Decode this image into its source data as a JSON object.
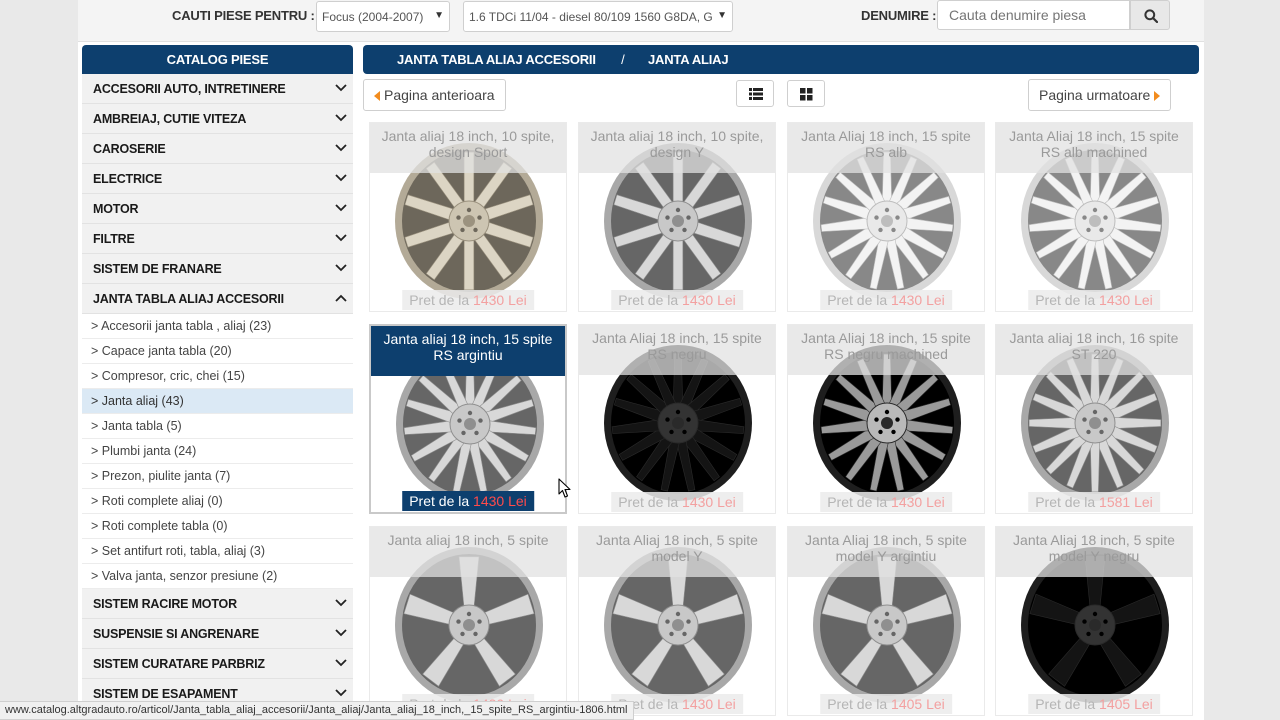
{
  "topbar": {
    "label_find": "CAUTI PIESE PENTRU :",
    "model_select": "Focus (2004-2007)",
    "engine_select": "1.6 TDCi 11/04 - diesel 80/109 1560 G8DA, G",
    "label_name": "DENUMIRE :",
    "search_placeholder": "Cauta denumire piesa"
  },
  "sidebar": {
    "title": "CATALOG PIESE",
    "categories_top": [
      "ACCESORII AUTO, INTRETINERE",
      "AMBREIAJ, CUTIE VITEZA",
      "CAROSERIE",
      "ELECTRICE",
      "MOTOR",
      "FILTRE",
      "SISTEM DE FRANARE"
    ],
    "expanded_category": "JANTA TABLA ALIAJ ACCESORII",
    "subcategories": [
      "> Accesorii janta tabla , aliaj (23)",
      "> Capace janta tabla (20)",
      "> Compresor, cric, chei (15)",
      "> Janta aliaj (43)",
      "> Janta tabla (5)",
      "> Plumbi janta (24)",
      "> Prezon, piulite janta (7)",
      "> Roti complete aliaj (0)",
      "> Roti complete tabla (0)",
      "> Set antifurt roti, tabla, aliaj (3)",
      "> Valva janta, senzor presiune (2)"
    ],
    "active_subcategory_index": 3,
    "categories_bottom": [
      "SISTEM RACIRE MOTOR",
      "SUSPENSIE SI ANGRENARE",
      "SISTEM CURATARE PARBRIZ",
      "SISTEM DE ESAPAMENT"
    ]
  },
  "breadcrumb": {
    "parent": "JANTA TABLA ALIAJ ACCESORII",
    "separator": "/",
    "current": "JANTA ALIAJ"
  },
  "pager": {
    "prev": "Pagina anterioara",
    "next": "Pagina urmatoare"
  },
  "price_prefix": "Pret de la",
  "currency": "Lei",
  "products": [
    {
      "title": "Janta aliaj 18 inch, 10 spite, design Sport",
      "price": "1430",
      "finish": "gold",
      "spokes": 10
    },
    {
      "title": "Janta aliaj 18 inch, 10 spite, design Y",
      "price": "1430",
      "finish": "silver",
      "spokes": 10
    },
    {
      "title": "Janta Aliaj 18 inch, 15 spite RS alb",
      "price": "1430",
      "finish": "white",
      "spokes": 15
    },
    {
      "title": "Janta Aliaj 18 inch, 15 spite RS alb machined",
      "price": "1430",
      "finish": "white",
      "spokes": 15
    },
    {
      "title": "Janta aliaj 18 inch, 15 spite RS argintiu",
      "price": "1430",
      "finish": "silver",
      "spokes": 15
    },
    {
      "title": "Janta Aliaj 18 inch, 15 spite RS negru",
      "price": "1430",
      "finish": "black",
      "spokes": 15
    },
    {
      "title": "Janta Aliaj 18 inch, 15 spite RS negru machined",
      "price": "1430",
      "finish": "blackmachined",
      "spokes": 15
    },
    {
      "title": "Janta aliaj 18 inch, 16 spite ST 220",
      "price": "1581",
      "finish": "silver",
      "spokes": 16
    },
    {
      "title": "Janta aliaj 18 inch, 5 spite",
      "price": "1430",
      "finish": "silver",
      "spokes": 5
    },
    {
      "title": "Janta Aliaj 18 inch, 5 spite model Y",
      "price": "1430",
      "finish": "silver",
      "spokes": 5
    },
    {
      "title": "Janta Aliaj 18 inch, 5 spite model Y argintiu",
      "price": "1405",
      "finish": "silver",
      "spokes": 5
    },
    {
      "title": "Janta Aliaj 18 inch, 5 spite model Y negru",
      "price": "1405",
      "finish": "black",
      "spokes": 5
    }
  ],
  "hovered_product_index": 4,
  "status_url": "www.catalog.altgradauto.ro/articol/Janta_tabla_aliaj_accesorii/Janta_aliaj/Janta_aliaj_18_inch,_15_spite_RS_argintiu-1806.html",
  "colors": {
    "brand_navy": "#0d3f6e",
    "price_red": "#ff4b4b",
    "pager_orange": "#f28c1e",
    "active_sub_bg": "#dbe9f5"
  }
}
